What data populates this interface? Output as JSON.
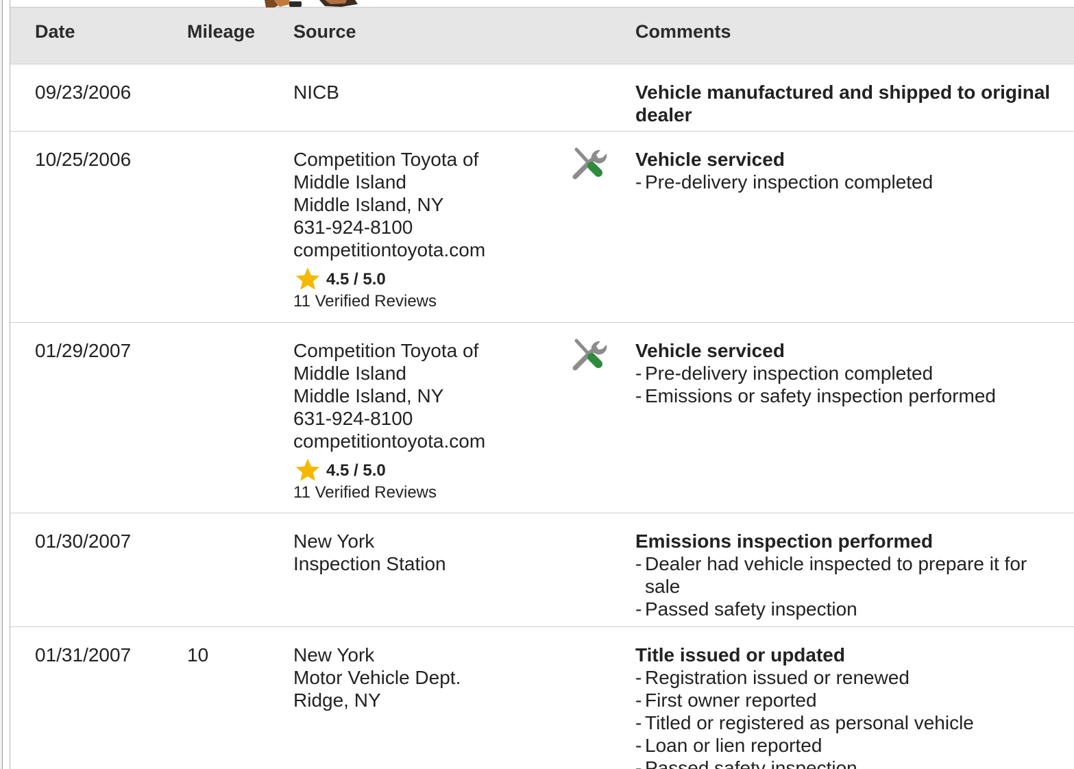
{
  "header": {
    "date": "Date",
    "mileage": "Mileage",
    "source": "Source",
    "comments": "Comments"
  },
  "colors": {
    "header_bg": "#e6e6e6",
    "row_border": "#cfcfcf",
    "star": "#f5b800",
    "wrench": "#8c8c8c",
    "screwdriver": "#2e8b3d"
  },
  "rows": [
    {
      "date": "09/23/2006",
      "mileage": "",
      "source": {
        "lines": [
          "NICB"
        ]
      },
      "comment_title": "Vehicle manufactured and shipped to original dealer",
      "bullets": []
    },
    {
      "date": "10/25/2006",
      "mileage": "",
      "source": {
        "lines": [
          "Competition Toyota of",
          "Middle Island",
          "Middle Island, NY",
          "631-924-8100",
          "competitiontoyota.com"
        ],
        "rating": "4.5 / 5.0",
        "reviews": "11 Verified Reviews"
      },
      "icon": "service-tools-icon",
      "comment_title": "Vehicle serviced",
      "bullets": [
        "Pre-delivery inspection completed"
      ]
    },
    {
      "date": "01/29/2007",
      "mileage": "",
      "source": {
        "lines": [
          "Competition Toyota of",
          "Middle Island",
          "Middle Island, NY",
          "631-924-8100",
          "competitiontoyota.com"
        ],
        "rating": "4.5 / 5.0",
        "reviews": "11 Verified Reviews"
      },
      "icon": "service-tools-icon",
      "comment_title": "Vehicle serviced",
      "bullets": [
        "Pre-delivery inspection completed",
        "Emissions or safety inspection performed"
      ]
    },
    {
      "date": "01/30/2007",
      "mileage": "",
      "source": {
        "lines": [
          "New York",
          "Inspection Station"
        ]
      },
      "comment_title": "Emissions inspection performed",
      "bullets": [
        "Dealer had vehicle inspected to prepare it for sale",
        "Passed safety inspection"
      ]
    },
    {
      "date": "01/31/2007",
      "mileage": "10",
      "source": {
        "lines": [
          "New York",
          "Motor Vehicle Dept.",
          "Ridge, NY"
        ]
      },
      "comment_title": "Title issued or updated",
      "bullets": [
        "Registration issued or renewed",
        "First owner reported",
        "Titled or registered as personal vehicle",
        "Loan or lien reported",
        "Passed safety inspection"
      ]
    }
  ]
}
